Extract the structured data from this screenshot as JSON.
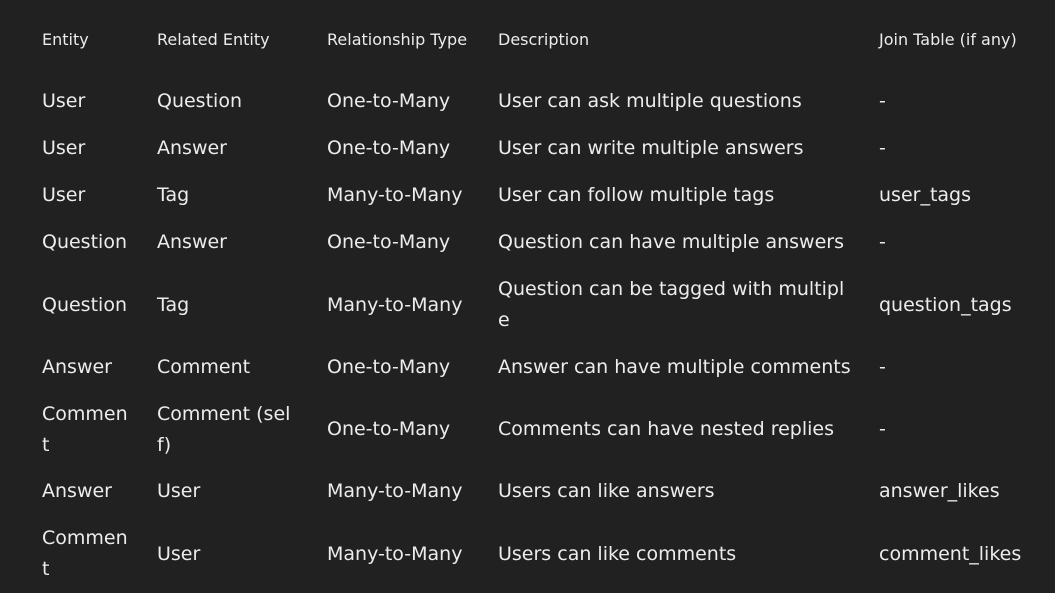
{
  "table": {
    "headers": [
      "Entity",
      "Related Entity",
      "Relationship Type",
      "Description",
      "Join Table (if any)"
    ],
    "rows": [
      [
        "User",
        "Question",
        "One-to-Many",
        "User can ask multiple questions",
        "-"
      ],
      [
        "User",
        "Answer",
        "One-to-Many",
        "User can write multiple answers",
        "-"
      ],
      [
        "User",
        "Tag",
        "Many-to-Many",
        "User can follow multiple tags",
        "user_tags"
      ],
      [
        "Question",
        "Answer",
        "One-to-Many",
        "Question can have multiple answers",
        "-"
      ],
      [
        "Question",
        "Tag",
        "Many-to-Many",
        "Question can be tagged with multiple",
        "question_tags"
      ],
      [
        "Answer",
        "Comment",
        "One-to-Many",
        "Answer can have multiple comments",
        "-"
      ],
      [
        "Comment",
        "Comment (self)",
        "One-to-Many",
        "Comments can have nested replies",
        "-"
      ],
      [
        "Answer",
        "User",
        "Many-to-Many",
        "Users can like answers",
        "answer_likes"
      ],
      [
        "Comment",
        "User",
        "Many-to-Many",
        "Users can like comments",
        "comment_likes"
      ]
    ]
  },
  "colors": {
    "background": "#212121",
    "text": "#ececec"
  }
}
